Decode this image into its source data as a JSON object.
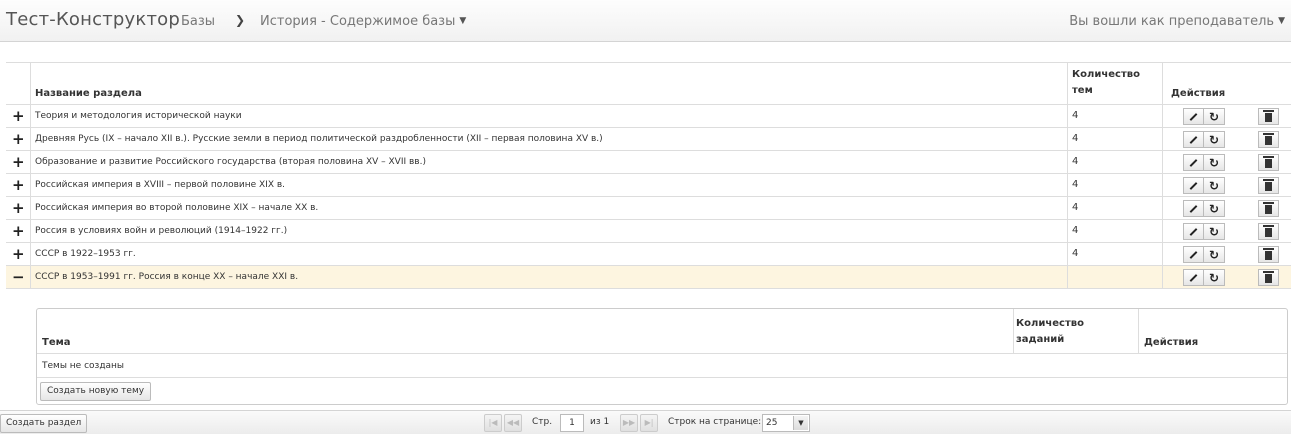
{
  "app": {
    "brand": "Тест-Конструктор",
    "breadcrumb": {
      "root": "Базы",
      "separator": "❯",
      "current": "История - Содержимое базы"
    },
    "user_menu": "Вы вошли как преподаватель"
  },
  "table": {
    "headers": {
      "name": "Название раздела",
      "count": "Количество тем",
      "actions": "Действия"
    },
    "rows": [
      {
        "toggle": "+",
        "name": "Теория и методология исторической науки",
        "count": "4"
      },
      {
        "toggle": "+",
        "name": "Древняя Русь (IX – начало XII в.). Русские земли в период политической раздробленности (XII – первая половина XV в.)",
        "count": "4"
      },
      {
        "toggle": "+",
        "name": "Образование и развитие Российского государства (вторая половина XV – XVII вв.)",
        "count": "4"
      },
      {
        "toggle": "+",
        "name": "Российская империя в XVIII – первой половине XIX в.",
        "count": "4"
      },
      {
        "toggle": "+",
        "name": "Российская империя во второй половине XIX – начале XX в.",
        "count": "4"
      },
      {
        "toggle": "+",
        "name": "Россия в условиях войн и революций (1914–1922 гг.)",
        "count": "4"
      },
      {
        "toggle": "+",
        "name": "СССР в 1922–1953 гг.",
        "count": "4"
      },
      {
        "toggle": "−",
        "name": "СССР в 1953–1991 гг. Россия в конце XX – начале XXI в.",
        "count": ""
      }
    ]
  },
  "subgrid": {
    "headers": {
      "theme": "Тема",
      "count": "Количество заданий",
      "actions": "Действия"
    },
    "empty_text": "Темы не созданы",
    "create_button": "Создать новую тему"
  },
  "footer": {
    "create_section_button": "Создать раздел",
    "page_label": "Стр.",
    "page_value": "1",
    "of_label": "из 1",
    "rows_label": "Строк на странице:",
    "rows_value": "25"
  }
}
